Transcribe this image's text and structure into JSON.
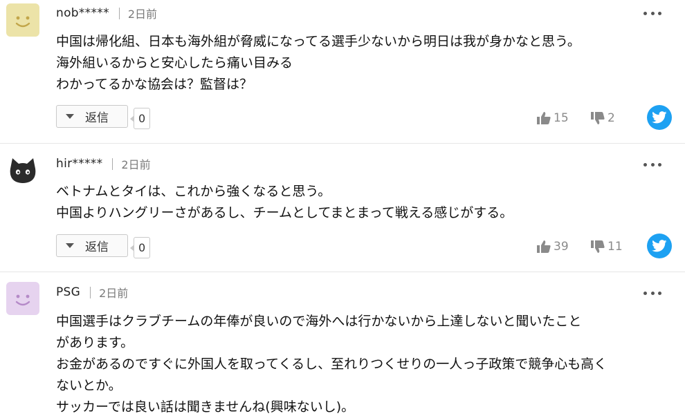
{
  "comments": [
    {
      "username": "nob*****",
      "time": "2日前",
      "lines": [
        "中国は帰化組、日本も海外組が脅威になってる選手少ないから明日は我が身かなと思う。",
        "海外組いるからと安心したら痛い目みる",
        "わかってるかな協会は？監督は？"
      ],
      "reply_label": "返信",
      "reply_count": "0",
      "likes": "15",
      "dislikes": "2",
      "avatar": "yellow-smiley-avatar"
    },
    {
      "username": "hir*****",
      "time": "2日前",
      "lines": [
        "ベトナムとタイは、これから強くなると思う。",
        "中国よりハングリーさがあるし、チームとしてまとまって戦える感じがする。"
      ],
      "reply_label": "返信",
      "reply_count": "0",
      "likes": "39",
      "dislikes": "11",
      "avatar": "black-cat-avatar"
    },
    {
      "username": "PSG",
      "time": "2日前",
      "lines": [
        "中国選手はクラブチームの年俸が良いので海外へは行かないから上達しないと聞いたこと",
        "があります。",
        "お金があるのですぐに外国人を取ってくるし、至れりつくせりの一人っ子政策で競争心も高く",
        "ないとか。",
        "サッカーでは良い話は聞きませんね(興味ないし)。"
      ],
      "avatar": "purple-smiley-avatar"
    }
  ],
  "colors": {
    "twitter": "#1da1f2",
    "avatar_yellow": "#ece3a8",
    "avatar_purple": "#e6d3ef",
    "divider": "#e6e6e6"
  }
}
